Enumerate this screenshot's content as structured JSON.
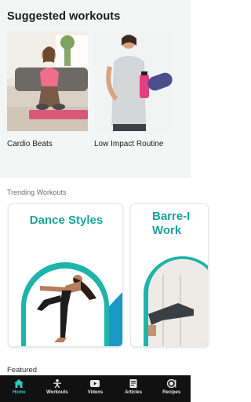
{
  "suggested": {
    "title": "Suggested workouts",
    "items": [
      {
        "label": "Cardio Beats"
      },
      {
        "label": "Low Impact Routine"
      }
    ]
  },
  "trending": {
    "title": "Trending Workouts",
    "cards": [
      {
        "title": "Dance Styles"
      },
      {
        "title": "Barre-I\nWork"
      }
    ]
  },
  "featured": {
    "title": "Featured"
  },
  "tabbar": {
    "items": [
      {
        "label": "Home",
        "icon": "home-icon",
        "active": true
      },
      {
        "label": "Workouts",
        "icon": "workouts-icon",
        "active": false
      },
      {
        "label": "Videos",
        "icon": "videos-icon",
        "active": false
      },
      {
        "label": "Articles",
        "icon": "articles-icon",
        "active": false
      },
      {
        "label": "Recipes",
        "icon": "recipes-icon",
        "active": false
      }
    ]
  },
  "colors": {
    "accent": "#2fc6bc",
    "card_title": "#1aa39c",
    "tabbar_bg": "#111111"
  }
}
